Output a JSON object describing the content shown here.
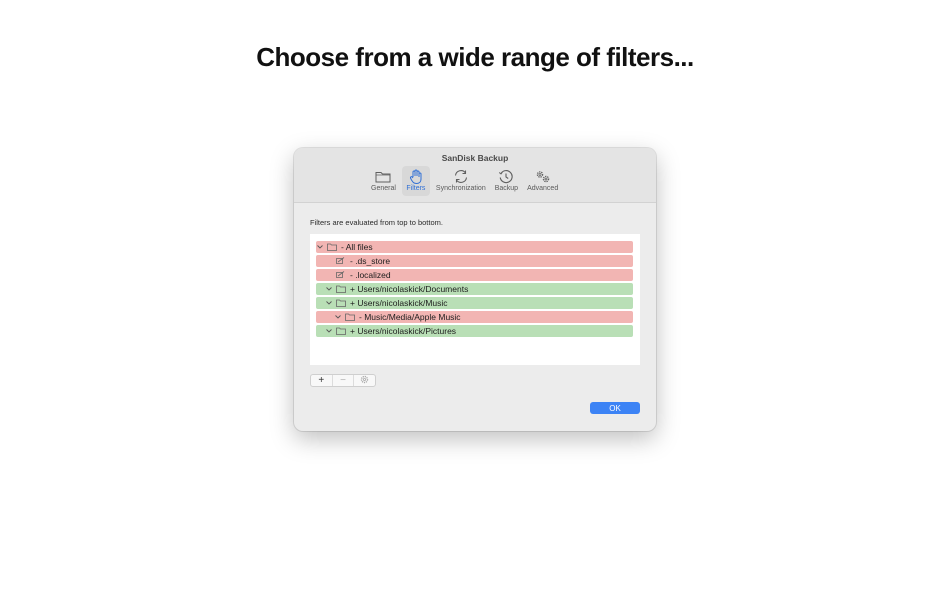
{
  "headline": "Choose from a wide range of filters...",
  "window": {
    "title": "SanDisk Backup",
    "tabs": [
      {
        "label": "General",
        "icon": "folder-icon",
        "active": false
      },
      {
        "label": "Filters",
        "icon": "hand-icon",
        "active": true
      },
      {
        "label": "Synchronization",
        "icon": "sync-icon",
        "active": false
      },
      {
        "label": "Backup",
        "icon": "clock-icon",
        "active": false
      },
      {
        "label": "Advanced",
        "icon": "gears-icon",
        "active": false
      }
    ],
    "description": "Filters are evaluated from top to bottom.",
    "filters": [
      {
        "text": "- All files",
        "type": "exclude",
        "indent": 0,
        "icon": "folder-icon",
        "chevron": true
      },
      {
        "text": "- .ds_store",
        "type": "exclude",
        "indent": 1,
        "icon": "pattern-icon",
        "chevron": false
      },
      {
        "text": "- .localized",
        "type": "exclude",
        "indent": 1,
        "icon": "pattern-icon",
        "chevron": false
      },
      {
        "text": "+ Users/nicolaskick/Documents",
        "type": "include",
        "indent": 1,
        "icon": "folder-icon",
        "chevron": true
      },
      {
        "text": "+ Users/nicolaskick/Music",
        "type": "include",
        "indent": 1,
        "icon": "folder-icon",
        "chevron": true
      },
      {
        "text": "- Music/Media/Apple Music",
        "type": "exclude",
        "indent": 2,
        "icon": "folder-icon",
        "chevron": true
      },
      {
        "text": "+ Users/nicolaskick/Pictures",
        "type": "include",
        "indent": 1,
        "icon": "folder-icon",
        "chevron": true
      }
    ],
    "buttons": {
      "add": "+",
      "remove": "−",
      "settings": "gear-icon"
    },
    "ok_label": "OK"
  },
  "colors": {
    "exclude": "#f2b5b3",
    "include": "#b9dfb6",
    "accent": "#3c83f5"
  }
}
